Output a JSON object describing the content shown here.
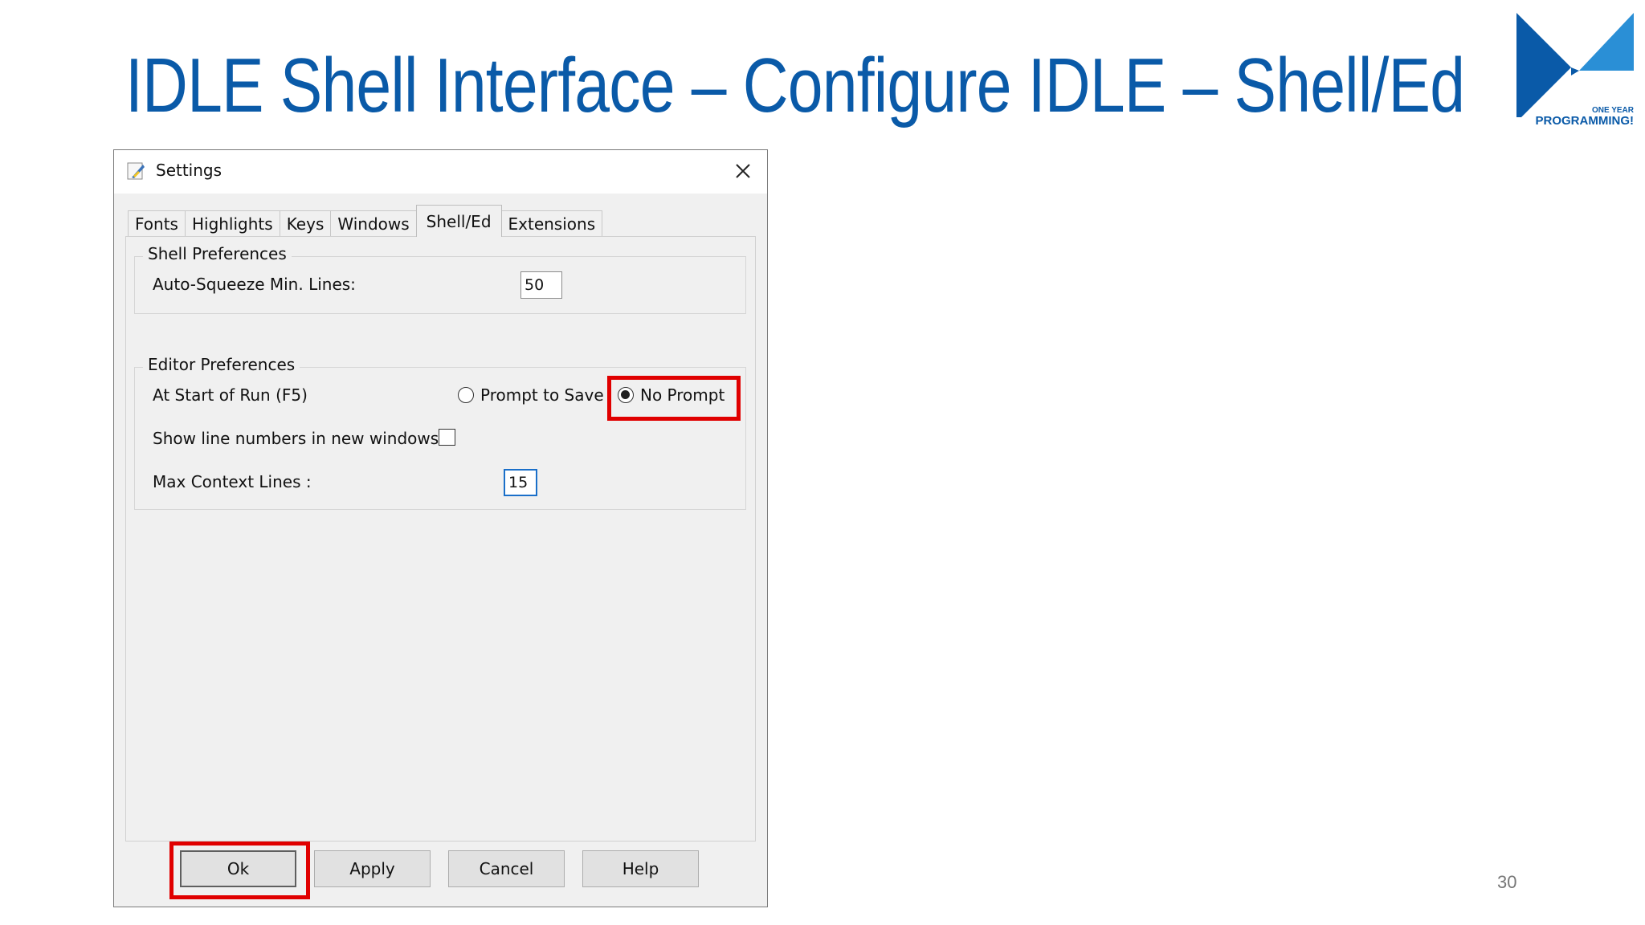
{
  "slide": {
    "title": "IDLE Shell  Interface – Configure IDLE – Shell/Ed",
    "page_number": "30",
    "logo": {
      "line1": "ONE YEAR",
      "line2": "PROGRAMMING!",
      "icon": "bowtie-logo-icon",
      "color": "#0a5aa8"
    }
  },
  "dialog": {
    "title": "Settings",
    "app_icon": "python-feather-icon",
    "close_icon": "close-icon",
    "tabs": [
      {
        "label": "Fonts"
      },
      {
        "label": "Highlights"
      },
      {
        "label": "Keys"
      },
      {
        "label": "Windows"
      },
      {
        "label": "Shell/Ed",
        "active": true
      },
      {
        "label": "Extensions"
      }
    ],
    "shell_prefs": {
      "group_label": "Shell Preferences",
      "auto_squeeze_label": "Auto-Squeeze Min. Lines:",
      "auto_squeeze_value": "50"
    },
    "editor_prefs": {
      "group_label": "Editor Preferences",
      "run_label": "At Start of Run (F5)",
      "prompt_to_save_label": "Prompt to Save",
      "no_prompt_label": "No Prompt",
      "selected": "No Prompt",
      "line_numbers_label": "Show line numbers in new windows",
      "line_numbers_checked": false,
      "max_context_label": "Max Context Lines :",
      "max_context_value": "15"
    },
    "buttons": {
      "ok": "Ok",
      "apply": "Apply",
      "cancel": "Cancel",
      "help": "Help"
    },
    "highlight_color": "#e00000"
  }
}
